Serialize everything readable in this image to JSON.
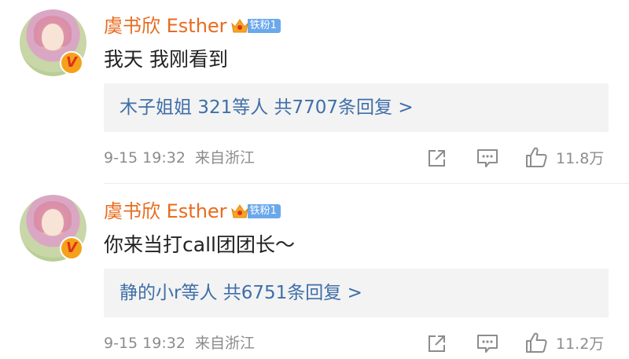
{
  "colors": {
    "username": "#e86b1f",
    "reply_link": "#3f6fa8",
    "meta": "#8c8c8c",
    "badge": "#6aa8ec",
    "reply_bg": "#f3f3f3"
  },
  "comments": [
    {
      "username": "虞书欣 Esther",
      "fan_badge": "铁粉1",
      "text": "我天 我刚看到",
      "reply_summary": "木子姐姐 321等人 共7707条回复 >",
      "time": "9-15 19:32",
      "location": "来自浙江",
      "like_count": "11.8万",
      "icons": [
        "share-icon",
        "comment-icon",
        "like-icon"
      ]
    },
    {
      "username": "虞书欣 Esther",
      "fan_badge": "铁粉1",
      "text": "你来当打call团团长～",
      "reply_summary": "静的小r等人 共6751条回复 >",
      "time": "9-15 19:32",
      "location": "来自浙江",
      "like_count": "11.2万",
      "icons": [
        "share-icon",
        "comment-icon",
        "like-icon"
      ]
    }
  ]
}
